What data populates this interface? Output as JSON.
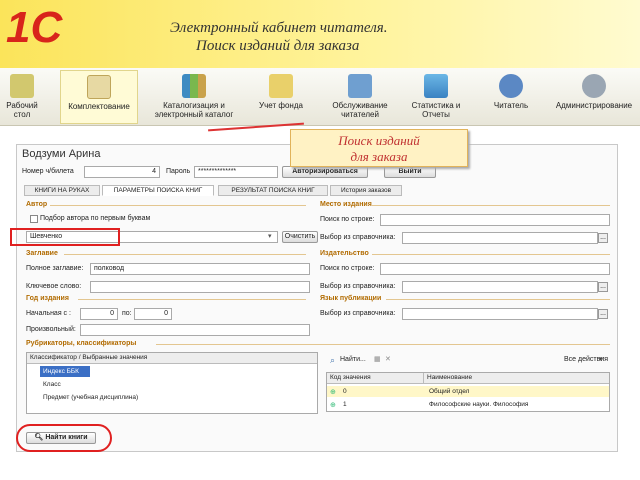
{
  "banner": {
    "logo_text": "1С",
    "title_line1": "Электронный кабинет читателя.",
    "title_line2": "Поиск изданий для заказа",
    "accent": "#d8241b"
  },
  "toolbar": {
    "items": [
      {
        "label": "Рабочий стол",
        "icon": "desktop-icon"
      },
      {
        "label": "Комплектование",
        "icon": "bag-icon"
      },
      {
        "label": "Каталогизация и электронный каталог",
        "icon": "books-icon"
      },
      {
        "label": "Учет фонда",
        "icon": "folder-icon"
      },
      {
        "label": "Обслуживание читателей",
        "icon": "book-icon"
      },
      {
        "label": "Статистика и Отчеты",
        "icon": "database-icon"
      },
      {
        "label": "Читатель",
        "icon": "user-icon"
      },
      {
        "label": "Администрирование",
        "icon": "gear-icon"
      }
    ]
  },
  "callout": {
    "line1": "Поиск изданий",
    "line2": "для заказа"
  },
  "form": {
    "reader_name": "Водзуми Арина",
    "card_label": "Номер ч/билета",
    "card_value": "4",
    "password_label": "Пароль",
    "password_value": "**************",
    "authorize_button": "Авторизироваться",
    "exit_button": "Выйти",
    "tabs": [
      "КНИГИ НА РУКАХ",
      "ПАРАМЕТРЫ ПОИСКА КНИГ",
      "РЕЗУЛЬТАТ ПОИСКА КНИГ",
      "История заказов"
    ],
    "author": {
      "section": "Автор",
      "checkbox_label": "Подбор автора по первым буквам",
      "value": "Шевченко",
      "clear_button": "Очистить"
    },
    "place": {
      "section": "Место издания",
      "search_label": "Поиск по строке:",
      "ref_label": "Выбор из справочника:"
    },
    "title": {
      "section": "Заглавие",
      "full_label": "Полное заглавие:",
      "full_value": "полковод",
      "keyword_label": "Ключевое слово:"
    },
    "publisher": {
      "section": "Издательство",
      "search_label": "Поиск по строке:",
      "ref_label": "Выбор из справочника:"
    },
    "year": {
      "section": "Год издания",
      "start_label": "Начальная с :",
      "start_value": "0",
      "to_label": "по:",
      "to_value": "0",
      "custom_label": "Произвольный:"
    },
    "language": {
      "section": "Язык публикации",
      "ref_label": "Выбор из справочника:"
    },
    "rubric": {
      "section": "Рубрикаторы, классификаторы",
      "tree_header": "Классификатор / Выбранные значения",
      "tree_rows": [
        "Индекс ББК",
        "Класс",
        "Предмет (учебная дисциплина)"
      ],
      "find_link": "Найти...",
      "all_actions": "Все действия",
      "grid_headers": [
        "Код значения",
        "Наименование"
      ],
      "grid_rows": [
        {
          "code": "0",
          "name": "Общий отдел"
        },
        {
          "code": "1",
          "name": "Философские науки. Философия"
        }
      ]
    },
    "find_books_button": "Найти книги",
    "dots": "..."
  }
}
